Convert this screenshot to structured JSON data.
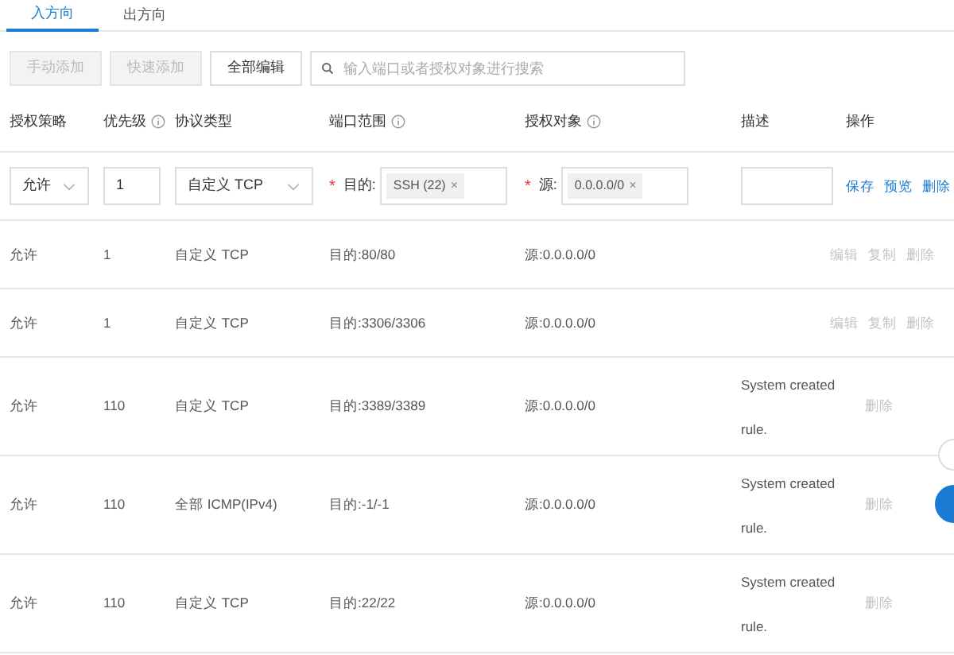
{
  "tabs": [
    {
      "label": "入方向",
      "selected": true
    },
    {
      "label": "出方向",
      "selected": false
    }
  ],
  "toolbar": {
    "buttons": [
      {
        "label": "手动添加",
        "disabled": true
      },
      {
        "label": "快速添加",
        "disabled": true
      },
      {
        "label": "全部编辑",
        "disabled": false
      }
    ],
    "search": {
      "placeholder": "输入端口或者授权对象进行搜索"
    }
  },
  "columns": [
    {
      "label": "授权策略",
      "info": false
    },
    {
      "label": "优先级",
      "info": true
    },
    {
      "label": "协议类型",
      "info": false
    },
    {
      "label": "端口范围",
      "info": true
    },
    {
      "label": "授权对象",
      "info": true
    },
    {
      "label": "描述",
      "info": false
    },
    {
      "label": "操作",
      "info": false
    }
  ],
  "edit_row": {
    "policy": "允许",
    "priority": "1",
    "protocol": "自定义 TCP",
    "required_mark": "*",
    "remove_icon": "×",
    "port_label": "目的:",
    "port_tag": "SSH (22)",
    "source_label": "源:",
    "source_tag": "0.0.0.0/0",
    "actions": [
      {
        "label": "保存",
        "disabled": false
      },
      {
        "label": "预览",
        "disabled": false
      },
      {
        "label": "删除",
        "disabled": false
      }
    ]
  },
  "rows": [
    {
      "policy": "允许",
      "priority": "1",
      "protocol": "自定义 TCP",
      "port": "目的:80/80",
      "source": "源:0.0.0.0/0",
      "actions": [
        {
          "label": "编辑",
          "disabled": true
        },
        {
          "label": "复制",
          "disabled": true
        },
        {
          "label": "删除",
          "disabled": true
        }
      ]
    },
    {
      "policy": "允许",
      "priority": "1",
      "protocol": "自定义 TCP",
      "port": "目的:3306/3306",
      "source": "源:0.0.0.0/0",
      "actions": [
        {
          "label": "编辑",
          "disabled": true
        },
        {
          "label": "复制",
          "disabled": true
        },
        {
          "label": "删除",
          "disabled": true
        }
      ]
    },
    {
      "policy": "允许",
      "priority": "110",
      "protocol": "自定义 TCP",
      "port": "目的:3389/3389",
      "source": "源:0.0.0.0/0",
      "description": "System created rule.",
      "actions": [
        {
          "label": "删除",
          "disabled": true
        }
      ]
    },
    {
      "policy": "允许",
      "priority": "110",
      "protocol": "全部 ICMP(IPv4)",
      "port": "目的:-1/-1",
      "source": "源:0.0.0.0/0",
      "description": "System created rule.",
      "actions": [
        {
          "label": "删除",
          "disabled": true
        }
      ]
    },
    {
      "policy": "允许",
      "priority": "110",
      "protocol": "自定义 TCP",
      "port": "目的:22/22",
      "source": "源:0.0.0.0/0",
      "description": "System created rule.",
      "actions": [
        {
          "label": "删除",
          "disabled": true
        }
      ]
    }
  ]
}
